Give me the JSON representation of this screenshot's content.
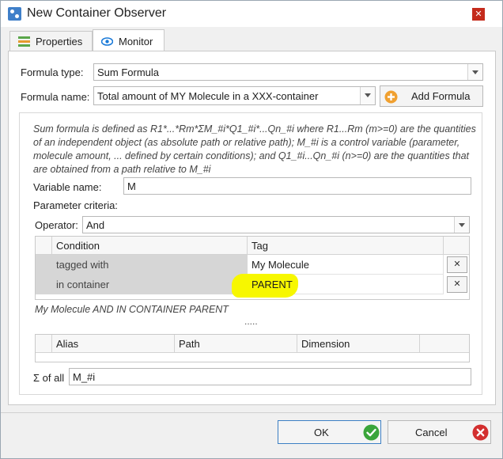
{
  "window": {
    "title": "New Container Observer",
    "close_glyph": "✕"
  },
  "tabs": [
    {
      "label": "Properties",
      "icon": "properties-icon",
      "active": false
    },
    {
      "label": "Monitor",
      "icon": "eye-icon",
      "active": true
    }
  ],
  "formula": {
    "type_label": "Formula type:",
    "type_value": "Sum Formula",
    "name_label": "Formula name:",
    "name_value": "Total amount of MY Molecule in a XXX-container",
    "add_button": "Add Formula"
  },
  "description": "Sum formula is defined as R1*...*Rm*ΣM_#i*Q1_#i*...Qn_#i where R1...Rm (m>=0) are the quantities of an independent object (as absolute path or relative path); M_#i is a control variable (parameter, molecule amount, ... defined by certain conditions); and Q1_#i...Qn_#i (n>=0) are the quantities that are obtained from a path relative to M_#i",
  "variable": {
    "label": "Variable name:",
    "value": "M"
  },
  "criteria": {
    "label": "Parameter criteria:",
    "operator_label": "Operator:",
    "operator_value": "And",
    "headers": [
      "Condition",
      "Tag"
    ],
    "rows": [
      {
        "condition": "tagged with",
        "tag": "My Molecule"
      },
      {
        "condition": "in container",
        "tag": "PARENT"
      }
    ],
    "remove_glyph": "✕",
    "summary": "My Molecule AND IN CONTAINER PARENT",
    "splitter": "....."
  },
  "paths": {
    "headers": [
      "Alias",
      "Path",
      "Dimension"
    ]
  },
  "sum": {
    "label": "Σ of all",
    "value": "M_#i"
  },
  "footer": {
    "ok": "OK",
    "cancel": "Cancel"
  },
  "colors": {
    "highlight": "#f7f700",
    "ok_green": "#3aa53a",
    "cancel_red": "#d32f2f",
    "accent_blue": "#1a7ad8"
  }
}
